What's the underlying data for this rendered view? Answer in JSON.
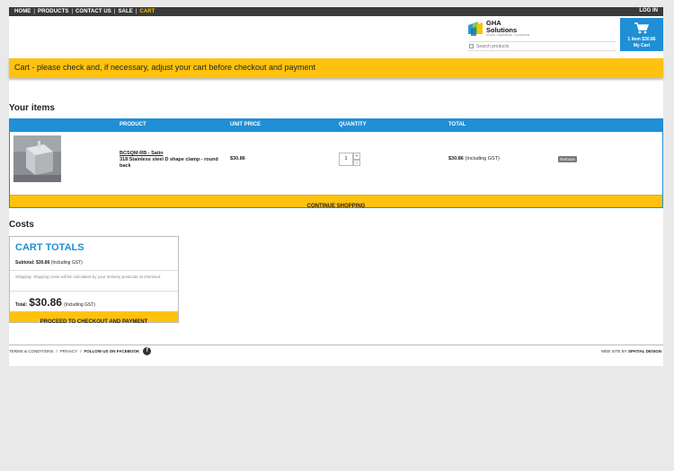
{
  "nav": {
    "links": [
      "HOME",
      "PRODUCTS",
      "CONTACT US",
      "SALE",
      "CART"
    ],
    "active": "CART",
    "login_label": "LOG IN"
  },
  "logo": {
    "brand": "GHA Solutions",
    "tagline": "GLASS • HARDWARE • ALUMINIUM"
  },
  "search": {
    "placeholder": "Search products"
  },
  "mini_cart": {
    "line1": "1 item $30.86",
    "line2": "My Cart"
  },
  "banner": {
    "text": "Cart - please check and, if necessary, adjust your cart before checkout and payment"
  },
  "items_section": {
    "title": "Your items",
    "columns": [
      "PRODUCT",
      "UNIT PRICE",
      "QUANTITY",
      "TOTAL"
    ],
    "rows": [
      {
        "code": "BCSQM-RB - Satin",
        "description": "318 Stainless steel D shape clamp - round back",
        "unit_price": "$30.86",
        "quantity": "1",
        "total": "$30.86",
        "total_suffix": "(Including GST)",
        "remove_label": "Remove"
      }
    ],
    "continue_label": "CONTINUE SHOPPING"
  },
  "costs_section": {
    "title": "Costs",
    "cart_totals_title": "CART TOTALS",
    "subtotal_label": "Subtotal:",
    "subtotal_value": "$30.86",
    "subtotal_suffix": "(Including GST)",
    "shipping_note": "Shipping: Shipping costs will be calculated by your delivery postcode at checkout.",
    "total_label": "Total:",
    "total_value": "$30.86",
    "total_suffix": "(Including GST)",
    "proceed_label": "PROCEED TO CHECKOUT AND PAYMENT"
  },
  "footer": {
    "terms": "TERMS & CONDITIONS",
    "privacy": "PRIVACY",
    "facebook": "FOLLOW US ON FACEBOOK",
    "credit_prefix": "WEB SITE BY",
    "credit_name": "SPATIAL DESIGN"
  },
  "colors": {
    "accent_blue": "#1f8fd6",
    "accent_yellow": "#ffc20e",
    "nav_bg": "#3a3a3a",
    "active_nav": "#f7c300"
  }
}
